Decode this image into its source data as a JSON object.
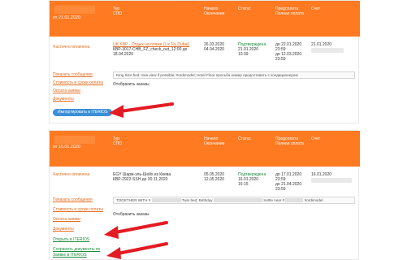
{
  "orders": [
    {
      "header": {
        "date_label": "от 21.01.2020",
        "col_tour": "Тур",
        "col_spo": "СПО",
        "col_start": "Начало",
        "col_end": "Окончание",
        "col_status": "Статус",
        "col_prepay": "Предоплата",
        "col_full": "Полная оплата",
        "col_invoice": "Счет"
      },
      "row": {
        "payment_status": "Частично оплачена",
        "tour_link": "UK KBP - Отдых на пляже (Lix Fly Dubai)",
        "spo": "КВР-3017-CHB_FZ_check_out_12:00 до 18.04.2020",
        "start": "26.03.2020",
        "end": "04.04.2020",
        "status": "Подтверждена",
        "status_date": "21.01.2020",
        "status_time": "10:39",
        "prepay_date": "до 22.01.2020",
        "prepay_time": "23:59",
        "full_date": "до 12.03.2020",
        "full_time": "23:59",
        "invoice": "21.01.2020"
      },
      "links": [
        "Показать сообщения",
        "Стоимость и сроки оплаты",
        "Оплата заявки",
        "Документы"
      ],
      "note": "King Size bed; Sea view if possible; #ordimodel; Hotel Floor просьба номер предоставить с кондиционером",
      "show_label": "Отобразить заказы",
      "import_button": "Импортировать в ITERIOS"
    },
    {
      "header": {
        "date_label": "от 16.01.2020",
        "col_tour": "Тур",
        "col_spo": "СПО",
        "col_start": "Начало",
        "col_end": "Окончание",
        "col_status": "Статус",
        "col_prepay": "Предоплата",
        "col_full": "Полная оплата",
        "col_invoice": "Счет"
      },
      "row": {
        "payment_status": "Частично оплачена",
        "tour_link": "EGY Шарм-эль-Шейх из Киева",
        "spo": "КВР-2922-SSH до 30.11.2020",
        "start": "05.05.2020",
        "end": "12.05.2020",
        "status": "Подтверждена",
        "status_date": "16.01.2020",
        "status_time": "15:15",
        "prepay_date": "до 17.01.2020",
        "prepay_time": "23:59",
        "full_date": "до 21.04.2020",
        "full_time": "23:59",
        "invoice": "16.01.2020"
      },
      "links": [
        "Показать сообщения",
        "Стоимость и сроки оплаты",
        "Оплата заявки",
        "Документы"
      ],
      "green_links": [
        "Открыть в ITERIOS",
        "Сохранить документы по",
        "Заявке в ITERIOS"
      ],
      "note_parts": [
        "TOGETHER WITH #",
        "Twin bed; Birthday",
        "Settle near #",
        "#ordimodel"
      ],
      "show_label": "Отобразить заказы"
    }
  ],
  "colors": {
    "header": "#ff7a21",
    "link": "#e46a1c",
    "confirmed": "#1d8a3a",
    "button": "#3b8fd8",
    "arrow": "#e31b23"
  }
}
